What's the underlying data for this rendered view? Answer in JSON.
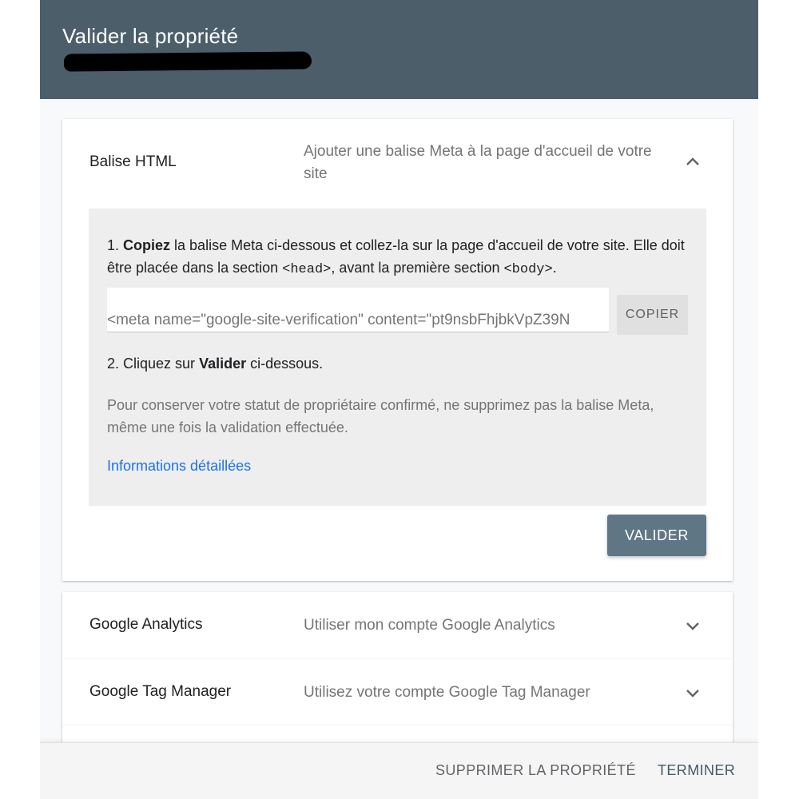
{
  "header": {
    "title": "Valider la propriété"
  },
  "methods": {
    "html_tag": {
      "title": "Balise HTML",
      "description": "Ajouter une balise Meta à la page d'accueil de votre site",
      "expanded": true,
      "step1_prefix": "1. ",
      "step1_bold": "Copiez",
      "step1_text": " la balise Meta ci-dessous et collez-la sur la page d'accueil de votre site. Elle doit être placée dans la section ",
      "step1_code_head": "<head>",
      "step1_text2": ", avant la première section ",
      "step1_code_body": "<body>",
      "step1_end": ".",
      "meta_tag_value": "<meta name=\"google-site-verification\" content=\"pt9nsbFhjbkVpZ39N",
      "copy_label": "COPIER",
      "step2_prefix": "2. Cliquez sur ",
      "step2_bold": "Valider",
      "step2_suffix": " ci-dessous.",
      "note": "Pour conserver votre statut de propriétaire confirmé, ne supprimez pas la balise Meta, même une fois la validation effectuée.",
      "details_link": "Informations détaillées",
      "validate_label": "VALIDER"
    },
    "google_analytics": {
      "title": "Google Analytics",
      "description": "Utiliser mon compte Google Analytics",
      "expanded": false
    },
    "google_tag_manager": {
      "title": "Google Tag Manager",
      "description": "Utilisez votre compte Google Tag Manager",
      "expanded": false
    }
  },
  "footer": {
    "delete_label": "SUPPRIMER LA PROPRIÉTÉ",
    "done_label": "TERMINER"
  },
  "colors": {
    "header_bg": "#4d5e6b",
    "validate_bg": "#5f7685",
    "link": "#1a73e8"
  },
  "icons": {
    "expand_less": "chevron-up-icon",
    "expand_more": "chevron-down-icon"
  }
}
